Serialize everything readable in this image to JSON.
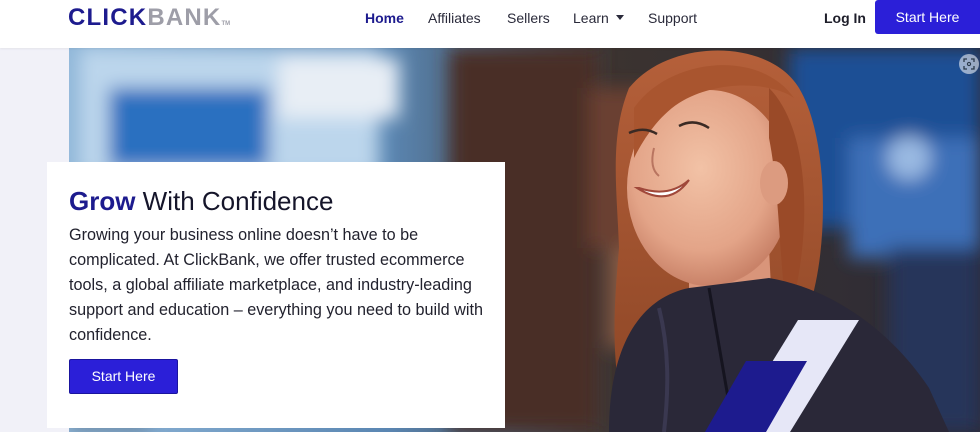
{
  "logo": {
    "brand_dark": "CLICK",
    "brand_light": "BANK",
    "tm": "TM"
  },
  "nav": {
    "items": [
      {
        "label": "Home",
        "active": true
      },
      {
        "label": "Affiliates",
        "active": false
      },
      {
        "label": "Sellers",
        "active": false
      },
      {
        "label": "Learn",
        "active": false,
        "has_dropdown": true
      },
      {
        "label": "Support",
        "active": false
      }
    ],
    "login_label": "Log In",
    "cta_label": "Start Here"
  },
  "hero": {
    "headline_accent": "Grow",
    "headline_rest": " With Confidence",
    "body": "Growing your business online doesn’t have to be complicated. At ClickBank, we offer trusted ecommerce tools, a global affiliate marketplace, and industry-leading support and education – everything you need to build with confidence.",
    "cta_label": "Start Here",
    "image_subject": "smiling woman with red hair in a dark jacket",
    "expand_icon": "expand-icon"
  },
  "colors": {
    "brand_navy": "#1d1b8e",
    "brand_blue": "#2b1fd8",
    "logo_gray": "#9e9ea8",
    "page_bg": "#f1f1f8"
  }
}
